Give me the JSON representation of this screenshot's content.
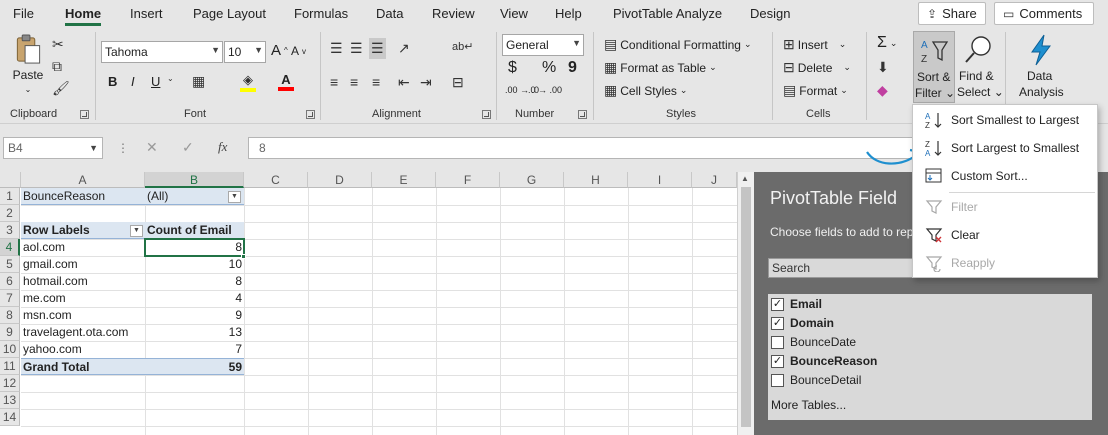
{
  "tabs": [
    "File",
    "Home",
    "Insert",
    "Page Layout",
    "Formulas",
    "Data",
    "Review",
    "View",
    "Help",
    "PivotTable Analyze",
    "Design"
  ],
  "active_tab": "Home",
  "top_buttons": {
    "share": "Share",
    "comments": "Comments"
  },
  "clipboard": {
    "paste": "Paste",
    "group": "Clipboard"
  },
  "font": {
    "name": "Tahoma",
    "size": "10",
    "grow": "A",
    "shrink": "A",
    "bold": "B",
    "italic": "I",
    "underline": "U",
    "group": "Font"
  },
  "alignment": {
    "group": "Alignment"
  },
  "number": {
    "format": "General",
    "currency": "$",
    "percent": "%",
    "comma": "9",
    "inc_dec": ".00 → .0",
    "dec_dec": ".0 → .00",
    "group": "Number"
  },
  "styles": {
    "conditional": "Conditional Formatting",
    "table": "Format as Table",
    "cell": "Cell Styles",
    "group": "Styles"
  },
  "cells": {
    "insert": "Insert",
    "delete": "Delete",
    "format": "Format",
    "group": "Cells"
  },
  "editing": {
    "sort_filter_l1": "Sort &",
    "sort_filter_l2": "Filter",
    "find_l1": "Find &",
    "find_l2": "Select",
    "sigma": "Σ"
  },
  "analysis": {
    "label_l1": "Data",
    "label_l2": "Analysis"
  },
  "formula_bar": {
    "name_box": "B4",
    "content": "8"
  },
  "columns": [
    "A",
    "B",
    "C",
    "D",
    "E",
    "F",
    "G",
    "H",
    "I",
    "J"
  ],
  "rows": [
    "1",
    "2",
    "3",
    "4",
    "5",
    "6",
    "7",
    "8",
    "9",
    "10",
    "11",
    "12",
    "13",
    "14"
  ],
  "pivot": {
    "filter_label": "BounceReason",
    "filter_value": "(All)",
    "header_left": "Row Labels",
    "header_right": "Count of Email",
    "rows": [
      {
        "label": "aol.com",
        "value": "8"
      },
      {
        "label": "gmail.com",
        "value": "10"
      },
      {
        "label": "hotmail.com",
        "value": "8"
      },
      {
        "label": "me.com",
        "value": "4"
      },
      {
        "label": "msn.com",
        "value": "9"
      },
      {
        "label": "travelagent.ota.com",
        "value": "13"
      },
      {
        "label": "yahoo.com",
        "value": "7"
      }
    ],
    "total_label": "Grand Total",
    "total_value": "59"
  },
  "pane": {
    "title": "PivotTable Field",
    "subtitle": "Choose fields to add to rep",
    "search_placeholder": "Search",
    "fields": [
      {
        "name": "Email",
        "checked": true
      },
      {
        "name": "Domain",
        "checked": true
      },
      {
        "name": "BounceDate",
        "checked": false
      },
      {
        "name": "BounceReason",
        "checked": true
      },
      {
        "name": "BounceDetail",
        "checked": false
      }
    ],
    "more_tables": "More Tables..."
  },
  "sort_menu": {
    "items": [
      {
        "label": "Sort Smallest to Largest",
        "icon": "sort-ascending-icon",
        "enabled": true
      },
      {
        "label": "Sort Largest to Smallest",
        "icon": "sort-descending-icon",
        "enabled": true
      },
      {
        "label": "Custom Sort...",
        "icon": "custom-sort-icon",
        "enabled": true
      },
      {
        "label": "Filter",
        "icon": "filter-icon",
        "enabled": false
      },
      {
        "label": "Clear",
        "icon": "clear-filter-icon",
        "enabled": true
      },
      {
        "label": "Reapply",
        "icon": "reapply-icon",
        "enabled": false
      }
    ]
  },
  "colors": {
    "accent": "#217346",
    "pane_bg": "#6b6b6b",
    "pivot_header": "#dce6f1",
    "arrow": "#1e8fcf"
  }
}
